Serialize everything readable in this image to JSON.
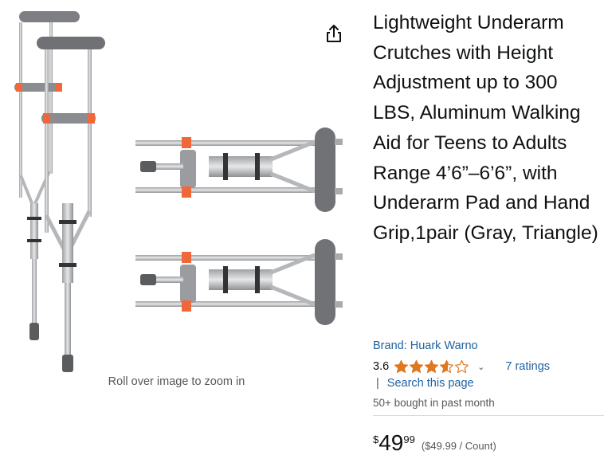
{
  "gallery": {
    "zoom_hint": "Roll over image to zoom in",
    "share_icon": "share-icon"
  },
  "product": {
    "title": "Lightweight Underarm Crutches with Height Adjustment up to 300 LBS, Aluminum Walking Aid for Teens to Adults Range 4’6”–6’6”, with Underarm Pad and Hand Grip,1pair (Gray, Triangle)",
    "brand": "Brand: Huark Warno",
    "rating_value": "3.6",
    "rating_stars": 3.6,
    "ratings_count": "7 ratings",
    "search_separator": "|",
    "search_label": "Search this page",
    "bought": "50+ bought in past month"
  },
  "price": {
    "symbol": "$",
    "whole": "49",
    "fraction": "99",
    "unit_price": "($49.99 / Count)"
  },
  "colors": {
    "star": "#de7921",
    "link": "#2162a1",
    "text": "#0f1111",
    "muted": "#565959",
    "accent_clip": "#f0683a"
  }
}
